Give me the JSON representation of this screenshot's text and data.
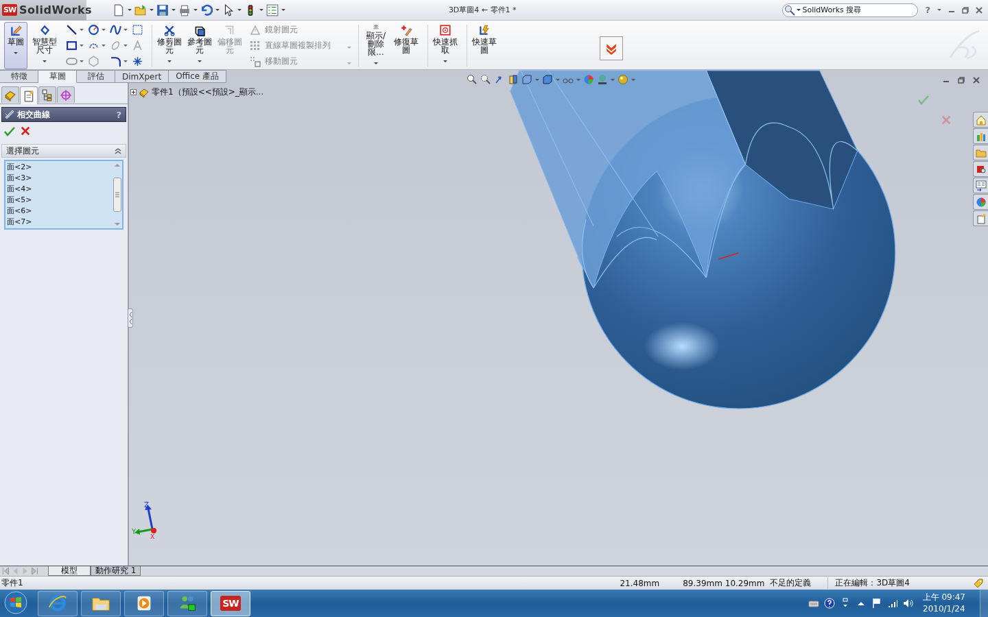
{
  "window": {
    "logo_mark": "SW",
    "app_name": "SolidWorks",
    "title": "3D草圖4 ← 零件1 *",
    "search_placeholder": "SolidWorks 搜尋",
    "help": "?"
  },
  "ribbon": {
    "tools": [
      {
        "kind": "large",
        "label": "草圖",
        "selected": true,
        "disabled": false,
        "has_menu": true
      },
      {
        "kind": "large",
        "label": "智慧型尺寸",
        "selected": false,
        "disabled": false,
        "has_menu": true
      },
      {
        "kind": "icon_grid"
      },
      {
        "kind": "separator"
      },
      {
        "kind": "large",
        "label": "修剪圖元",
        "selected": false,
        "disabled": false,
        "has_menu": true
      },
      {
        "kind": "large",
        "label": "參考圖元",
        "selected": false,
        "disabled": false,
        "has_menu": true
      },
      {
        "kind": "large",
        "label": "偏移圖元",
        "selected": false,
        "disabled": true,
        "has_menu": false
      },
      {
        "kind": "row",
        "label": "鏡射圖元",
        "disabled": true,
        "has_menu": false
      },
      {
        "kind": "row",
        "label": "直線草圖複製排列",
        "disabled": true,
        "has_menu": true
      },
      {
        "kind": "row",
        "label": "移動圖元",
        "disabled": true,
        "has_menu": true
      },
      {
        "kind": "separator"
      },
      {
        "kind": "large",
        "label": "顯示/刪除限...",
        "selected": false,
        "disabled": false,
        "has_menu": true
      },
      {
        "kind": "large",
        "label": "修復草圖",
        "selected": false,
        "disabled": false,
        "has_menu": false
      },
      {
        "kind": "separator"
      },
      {
        "kind": "large",
        "label": "快速抓取",
        "selected": false,
        "disabled": false,
        "has_menu": true
      },
      {
        "kind": "separator"
      },
      {
        "kind": "large",
        "label": "快速草圖",
        "selected": false,
        "disabled": false,
        "has_menu": false
      }
    ]
  },
  "command_tabs": [
    {
      "label": "特徵",
      "selected": false
    },
    {
      "label": "草圖",
      "selected": true
    },
    {
      "label": "評估",
      "selected": false
    },
    {
      "label": "DimXpert",
      "selected": false
    },
    {
      "label": "Office 產品",
      "selected": false
    }
  ],
  "panel_tabs": [
    {
      "selected": false
    },
    {
      "selected": true
    },
    {
      "selected": false
    },
    {
      "selected": false
    }
  ],
  "property_manager": {
    "title": "相交曲線",
    "help": "?",
    "group_title": "選擇圖元",
    "selections": [
      "面<2>",
      "面<3>",
      "面<4>",
      "面<5>",
      "面<6>",
      "面<7>"
    ]
  },
  "viewport": {
    "tree_item": "零件1（預設<<預設>_顯示...",
    "triad_labels": [
      "Z",
      "Y",
      "X"
    ]
  },
  "bottom_tabs": [
    {
      "label": "模型",
      "selected": true
    },
    {
      "label": "動作研究 1",
      "selected": false
    }
  ],
  "status_bar": {
    "document": "零件1",
    "readouts": [
      "21.48mm",
      "89.39mm 10.29mm",
      "不足的定義",
      "正在編輯：3D草圖4"
    ]
  },
  "taskbar": {
    "apps": [
      {
        "kind": "browser",
        "selected": false
      },
      {
        "kind": "folder",
        "selected": false
      },
      {
        "kind": "media",
        "selected": false
      },
      {
        "kind": "messenger",
        "selected": false
      },
      {
        "kind": "solidworks",
        "selected": true,
        "label": "SW"
      }
    ],
    "time": "上午 09:47",
    "date": "2010/1/24"
  }
}
